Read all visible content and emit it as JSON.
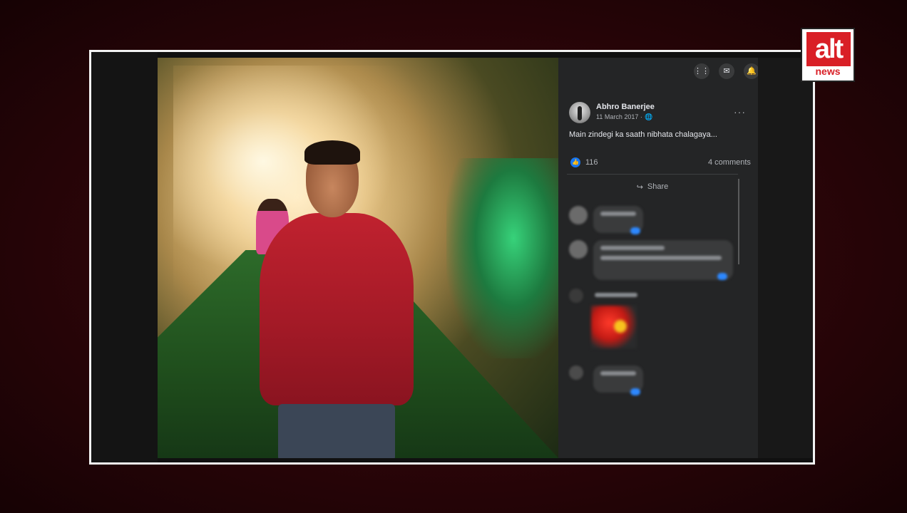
{
  "logo": {
    "top": "alt",
    "bottom": "news"
  },
  "post": {
    "author": "Abhro Banerjee",
    "date": "11 March 2017 · ",
    "privacy_icon": "🌐",
    "caption": "Main zindegi ka saath nibhata chalagaya...",
    "like_count": "116",
    "comments_count": "4 comments",
    "share_label": "Share",
    "more_label": "···"
  },
  "topbar": {
    "menu_icon": "⋮⋮",
    "messenger_icon": "✉",
    "bell_icon": "🔔"
  },
  "colors": {
    "accent": "#1877f2",
    "panel": "#242526",
    "brand_red": "#d91f26"
  }
}
